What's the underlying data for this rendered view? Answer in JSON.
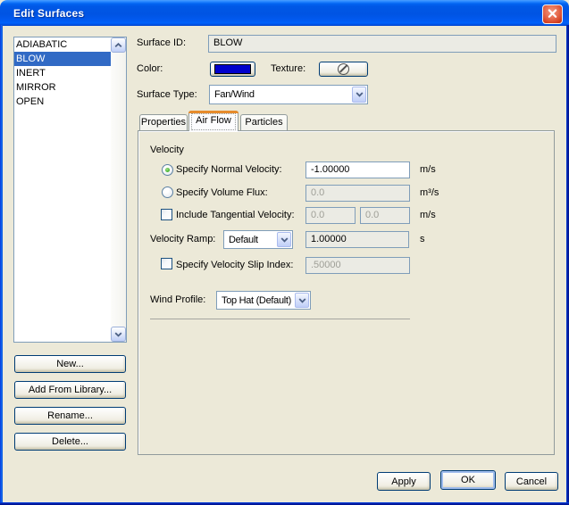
{
  "window": {
    "title": "Edit Surfaces"
  },
  "surface_list": {
    "items": [
      "ADIABATIC",
      "BLOW",
      "INERT",
      "MIRROR",
      "OPEN"
    ],
    "selected": "BLOW"
  },
  "list_buttons": {
    "new": "New...",
    "add_from_library": "Add From Library...",
    "rename": "Rename...",
    "delete": "Delete..."
  },
  "fields": {
    "surface_id": {
      "label": "Surface ID:",
      "value": "BLOW"
    },
    "color": {
      "label": "Color:",
      "swatch": "#0000cc"
    },
    "texture": {
      "label": "Texture:"
    },
    "surface_type": {
      "label": "Surface Type:",
      "value": "Fan/Wind"
    }
  },
  "tabs": {
    "properties": "Properties",
    "air_flow": "Air Flow",
    "particles": "Particles",
    "active": "Air Flow"
  },
  "air_flow": {
    "group_label": "Velocity",
    "normal_velocity": {
      "label": "Specify Normal Velocity:",
      "value": "-1.00000",
      "unit": "m/s",
      "selected": true
    },
    "volume_flux": {
      "label": "Specify Volume Flux:",
      "value": "0.0",
      "unit": "m³/s",
      "selected": false
    },
    "tangential": {
      "label": "Include Tangential Velocity:",
      "value1": "0.0",
      "value2": "0.0",
      "unit": "m/s",
      "checked": false
    },
    "velocity_ramp": {
      "label": "Velocity Ramp:",
      "option": "Default",
      "value": "1.00000",
      "unit": "s"
    },
    "slip_index": {
      "label": "Specify Velocity Slip Index:",
      "value": ".50000",
      "checked": false
    },
    "wind_profile": {
      "label": "Wind Profile:",
      "option": "Top Hat (Default)"
    }
  },
  "dialog_buttons": {
    "apply": "Apply",
    "ok": "OK",
    "cancel": "Cancel"
  },
  "colors": {
    "titlebar": "#0054e3",
    "selection": "#316ac5",
    "field_disabled_bg": "#ebebe4",
    "swatch": "#0000cc",
    "active_tab_highlight": "#e68b2c"
  }
}
